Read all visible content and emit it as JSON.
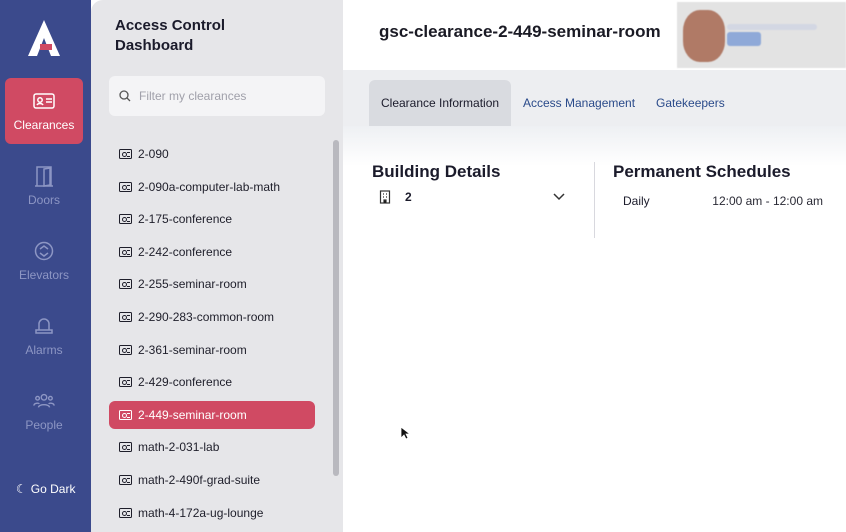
{
  "nav": {
    "items": [
      {
        "label": "Clearances",
        "icon": "id-card-icon",
        "active": true
      },
      {
        "label": "Doors",
        "icon": "door-icon",
        "active": false
      },
      {
        "label": "Elevators",
        "icon": "elevator-icon",
        "active": false
      },
      {
        "label": "Alarms",
        "icon": "alarm-icon",
        "active": false
      },
      {
        "label": "People",
        "icon": "people-icon",
        "active": false
      }
    ],
    "go_dark_label": "Go Dark"
  },
  "panel": {
    "title": "Access Control Dashboard",
    "search_placeholder": "Filter my clearances",
    "clearances": [
      "2-090",
      "2-090a-computer-lab-math",
      "2-175-conference",
      "2-242-conference",
      "2-255-seminar-room",
      "2-290-283-common-room",
      "2-361-seminar-room",
      "2-429-conference",
      "2-449-seminar-room",
      "math-2-031-lab",
      "math-2-490f-grad-suite",
      "math-4-172a-ug-lounge"
    ],
    "selected": "2-449-seminar-room"
  },
  "main": {
    "title": "gsc-clearance-2-449-seminar-room",
    "tabs": [
      {
        "label": "Clearance Information",
        "active": true
      },
      {
        "label": "Access Management",
        "active": false
      },
      {
        "label": "Gatekeepers",
        "active": false
      }
    ],
    "building": {
      "heading": "Building Details",
      "value": "2"
    },
    "schedules": {
      "heading": "Permanent Schedules",
      "rows": [
        {
          "frequency": "Daily",
          "time": "12:00 am - 12:00 am"
        }
      ]
    }
  },
  "colors": {
    "rail": "#3b4a8c",
    "accent": "#d04a63",
    "panel": "#e6e6e9",
    "tab_link": "#2a4a8a"
  }
}
